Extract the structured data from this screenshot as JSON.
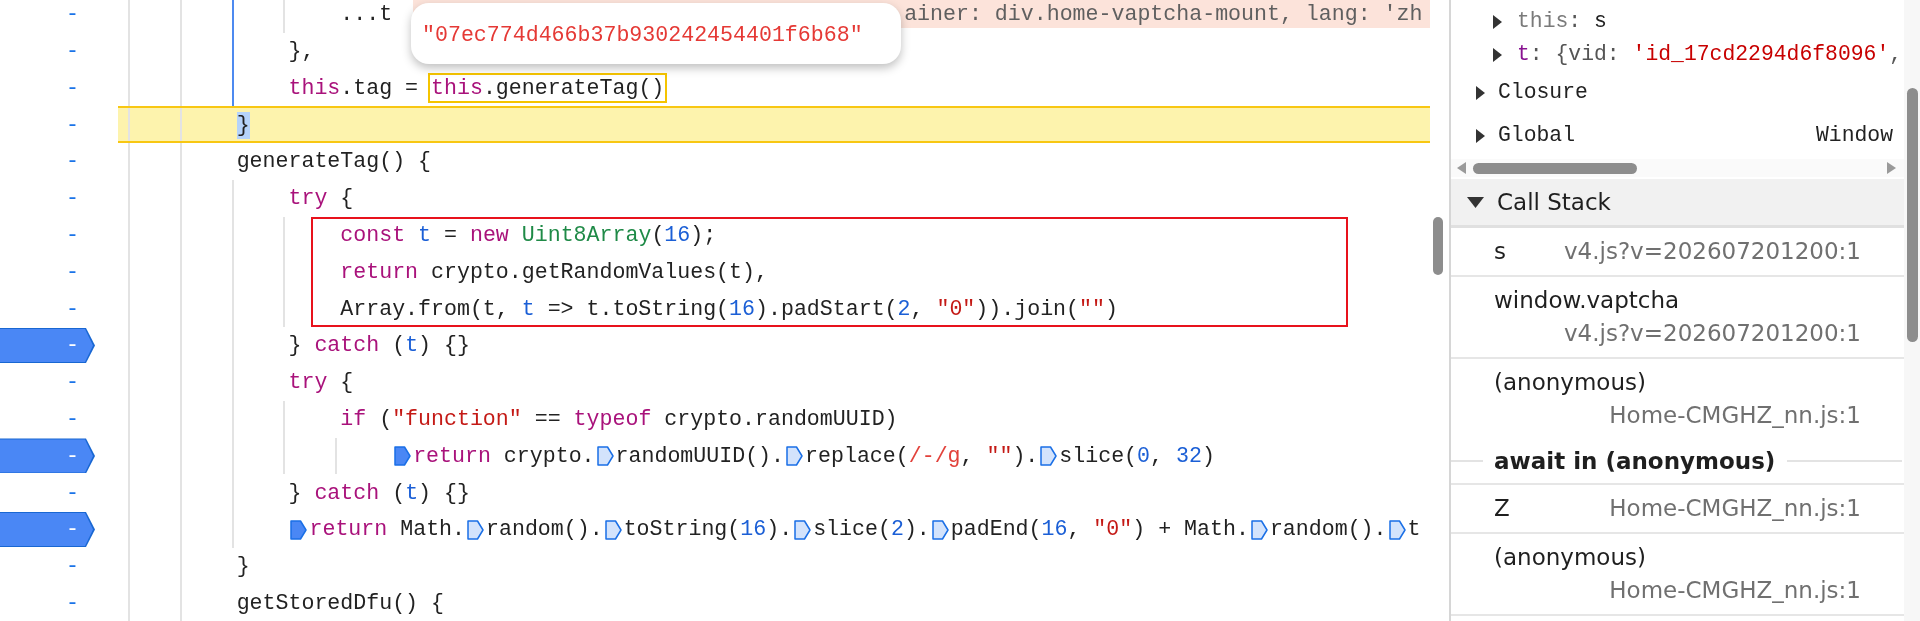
{
  "code_editor": {
    "lines": [
      {
        "scope_highlighted": true,
        "children": [
          {
            "scope_highlighted": false,
            "children": [
              {
                "line_number": "-",
                "breakpoint": false,
                "paused": false,
                "annotated": false,
                "tokens": [
                  {
                    "kind": "plain",
                    "text": "...t"
                  },
                  {
                    "kind": "inline_value",
                    "text": "ainer: div.home-vaptcha-mount, lang: 'zh"
                  }
                ]
              }
            ]
          },
          {
            "line_number": "-",
            "breakpoint": false,
            "paused": false,
            "annotated": false,
            "tokens": [
              {
                "kind": "plain",
                "text": "},"
              }
            ]
          },
          {
            "line_number": "-",
            "breakpoint": false,
            "paused": false,
            "annotated": false,
            "tokens": [
              {
                "kind": "keyword",
                "text": "this"
              },
              {
                "kind": "plain",
                "text": ".tag = "
              },
              {
                "kind": "hovered",
                "tokens": [
                  {
                    "kind": "keyword",
                    "text": "this"
                  },
                  {
                    "kind": "plain",
                    "text": ".generateTag()"
                  }
                ]
              }
            ]
          }
        ]
      },
      {
        "line_number": "-",
        "breakpoint": false,
        "paused": true,
        "annotated": false,
        "tokens": [
          {
            "kind": "matched_bracket",
            "text": "}"
          }
        ]
      },
      {
        "line_number": "-",
        "breakpoint": false,
        "paused": false,
        "annotated": false,
        "tokens": [
          {
            "kind": "plain",
            "text": "generateTag() {"
          }
        ],
        "scope_highlighted": false,
        "children": [
          {
            "line_number": "-",
            "breakpoint": false,
            "paused": false,
            "annotated": false,
            "tokens": [
              {
                "kind": "keyword",
                "text": "try"
              },
              {
                "kind": "plain",
                "text": " {"
              }
            ],
            "scope_highlighted": false,
            "children": [
              {
                "line_number": "-",
                "breakpoint": false,
                "paused": false,
                "annotated": true,
                "tokens": [
                  {
                    "kind": "keyword",
                    "text": "const "
                  },
                  {
                    "kind": "def",
                    "text": "t"
                  },
                  {
                    "kind": "plain",
                    "text": " = "
                  },
                  {
                    "kind": "keyword",
                    "text": "new "
                  },
                  {
                    "kind": "type",
                    "text": "Uint8Array"
                  },
                  {
                    "kind": "plain",
                    "text": "("
                  },
                  {
                    "kind": "number",
                    "text": "16"
                  },
                  {
                    "kind": "plain",
                    "text": ");"
                  }
                ]
              },
              {
                "line_number": "-",
                "breakpoint": false,
                "paused": false,
                "annotated": true,
                "tokens": [
                  {
                    "kind": "keyword",
                    "text": "return"
                  },
                  {
                    "kind": "plain",
                    "text": " crypto.getRandomValues(t),"
                  }
                ]
              },
              {
                "line_number": "-",
                "breakpoint": false,
                "paused": false,
                "annotated": true,
                "tokens": [
                  {
                    "kind": "plain",
                    "text": "Array.from(t, "
                  },
                  {
                    "kind": "def",
                    "text": "t"
                  },
                  {
                    "kind": "plain",
                    "text": " => t.toString("
                  },
                  {
                    "kind": "number",
                    "text": "16"
                  },
                  {
                    "kind": "plain",
                    "text": ").padStart("
                  },
                  {
                    "kind": "number",
                    "text": "2"
                  },
                  {
                    "kind": "plain",
                    "text": ", "
                  },
                  {
                    "kind": "string",
                    "text": "\"0\""
                  },
                  {
                    "kind": "plain",
                    "text": ")).join("
                  },
                  {
                    "kind": "string",
                    "text": "\"\""
                  },
                  {
                    "kind": "plain",
                    "text": ")"
                  }
                ]
              }
            ]
          },
          {
            "line_number": "-",
            "breakpoint": true,
            "paused": false,
            "annotated": false,
            "tokens": [
              {
                "kind": "plain",
                "text": "} "
              },
              {
                "kind": "keyword",
                "text": "catch"
              },
              {
                "kind": "plain",
                "text": " ("
              },
              {
                "kind": "def",
                "text": "t"
              },
              {
                "kind": "plain",
                "text": ") {}"
              }
            ]
          },
          {
            "line_number": "-",
            "breakpoint": false,
            "paused": false,
            "annotated": false,
            "tokens": [
              {
                "kind": "keyword",
                "text": "try"
              },
              {
                "kind": "plain",
                "text": " {"
              }
            ],
            "scope_highlighted": false,
            "children": [
              {
                "line_number": "-",
                "breakpoint": false,
                "paused": false,
                "annotated": false,
                "tokens": [
                  {
                    "kind": "keyword",
                    "text": "if"
                  },
                  {
                    "kind": "plain",
                    "text": " ("
                  },
                  {
                    "kind": "string",
                    "text": "\"function\""
                  },
                  {
                    "kind": "plain",
                    "text": " == "
                  },
                  {
                    "kind": "keyword",
                    "text": "typeof"
                  },
                  {
                    "kind": "plain",
                    "text": " crypto.randomUUID)"
                  }
                ],
                "scope_highlighted": false,
                "children": [
                  {
                    "line_number": "-",
                    "breakpoint": true,
                    "paused": false,
                    "annotated": false,
                    "tokens": [
                      {
                        "kind": "breakpoint_marker",
                        "active": true
                      },
                      {
                        "kind": "keyword",
                        "text": "return"
                      },
                      {
                        "kind": "plain",
                        "text": " crypto."
                      },
                      {
                        "kind": "breakpoint_marker",
                        "active": false
                      },
                      {
                        "kind": "plain",
                        "text": "randomUUID()."
                      },
                      {
                        "kind": "breakpoint_marker",
                        "active": false
                      },
                      {
                        "kind": "plain",
                        "text": "replace("
                      },
                      {
                        "kind": "regex",
                        "text": "/-/g"
                      },
                      {
                        "kind": "plain",
                        "text": ", "
                      },
                      {
                        "kind": "string",
                        "text": "\"\""
                      },
                      {
                        "kind": "plain",
                        "text": ")."
                      },
                      {
                        "kind": "breakpoint_marker",
                        "active": false
                      },
                      {
                        "kind": "plain",
                        "text": "slice("
                      },
                      {
                        "kind": "number",
                        "text": "0"
                      },
                      {
                        "kind": "plain",
                        "text": ", "
                      },
                      {
                        "kind": "number",
                        "text": "32"
                      },
                      {
                        "kind": "plain",
                        "text": ")"
                      }
                    ]
                  }
                ]
              }
            ]
          },
          {
            "line_number": "-",
            "breakpoint": false,
            "paused": false,
            "annotated": false,
            "tokens": [
              {
                "kind": "plain",
                "text": "} "
              },
              {
                "kind": "keyword",
                "text": "catch"
              },
              {
                "kind": "plain",
                "text": " ("
              },
              {
                "kind": "def",
                "text": "t"
              },
              {
                "kind": "plain",
                "text": ") {}"
              }
            ]
          },
          {
            "line_number": "-",
            "breakpoint": true,
            "paused": false,
            "annotated": false,
            "tokens": [
              {
                "kind": "breakpoint_marker",
                "active": true
              },
              {
                "kind": "keyword",
                "text": "return"
              },
              {
                "kind": "plain",
                "text": " Math."
              },
              {
                "kind": "breakpoint_marker",
                "active": false
              },
              {
                "kind": "plain",
                "text": "random()."
              },
              {
                "kind": "breakpoint_marker",
                "active": false
              },
              {
                "kind": "plain",
                "text": "toString("
              },
              {
                "kind": "number",
                "text": "16"
              },
              {
                "kind": "plain",
                "text": ")."
              },
              {
                "kind": "breakpoint_marker",
                "active": false
              },
              {
                "kind": "plain",
                "text": "slice("
              },
              {
                "kind": "number",
                "text": "2"
              },
              {
                "kind": "plain",
                "text": ")."
              },
              {
                "kind": "breakpoint_marker",
                "active": false
              },
              {
                "kind": "plain",
                "text": "padEnd("
              },
              {
                "kind": "number",
                "text": "16"
              },
              {
                "kind": "plain",
                "text": ", "
              },
              {
                "kind": "string",
                "text": "\"0\""
              },
              {
                "kind": "plain",
                "text": ") + Math."
              },
              {
                "kind": "breakpoint_marker",
                "active": false
              },
              {
                "kind": "plain",
                "text": "random()."
              },
              {
                "kind": "breakpoint_marker",
                "active": false
              },
              {
                "kind": "plain",
                "text": "t"
              }
            ]
          }
        ]
      },
      {
        "line_number": "-",
        "breakpoint": false,
        "paused": false,
        "annotated": false,
        "tokens": [
          {
            "kind": "plain",
            "text": "}"
          }
        ]
      },
      {
        "line_number": "-",
        "breakpoint": false,
        "paused": false,
        "annotated": false,
        "tokens": [
          {
            "kind": "plain",
            "text": "getStoredDfu() {"
          }
        ]
      }
    ],
    "hover_tooltip": "\"07ec774d466b37b930242454401f6b68\""
  },
  "scope_panel": {
    "local_variables": [
      {
        "expanded": false,
        "tokens": [
          {
            "kind": "receiver_name",
            "text": "this"
          },
          {
            "kind": "punct",
            "text": ": "
          },
          {
            "kind": "plain",
            "text": "s"
          }
        ]
      },
      {
        "expanded": false,
        "tokens": [
          {
            "kind": "property_name",
            "text": "t"
          },
          {
            "kind": "punct",
            "text": ": {vid: "
          },
          {
            "kind": "string",
            "text": "'id_17cd2294d6f8096'"
          },
          {
            "kind": "punct",
            "text": ","
          }
        ]
      }
    ],
    "scopes": [
      {
        "name": "Closure",
        "expanded": false
      },
      {
        "name": "Global",
        "expanded": false,
        "value": "Window"
      }
    ]
  },
  "call_stack": {
    "title": "Call Stack",
    "expanded": true,
    "frames": [
      {
        "kind": "frame",
        "function": "s",
        "location": "v4.js?v=202607201200:1"
      },
      {
        "kind": "frame",
        "function": "window.vaptcha",
        "location": "v4.js?v=202607201200:1"
      },
      {
        "kind": "frame",
        "function": "(anonymous)",
        "location": "Home-CMGHZ_nn.js:1"
      },
      {
        "kind": "async",
        "label": "await in (anonymous)"
      },
      {
        "kind": "frame",
        "function": "Z",
        "location": "Home-CMGHZ_nn.js:1"
      },
      {
        "kind": "frame",
        "function": "(anonymous)",
        "location": "Home-CMGHZ_nn.js:1"
      }
    ]
  }
}
